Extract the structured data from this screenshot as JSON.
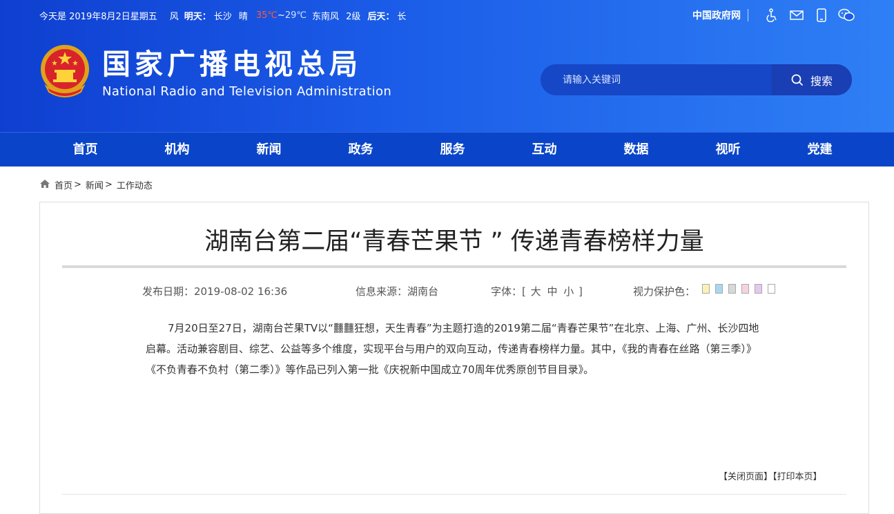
{
  "topbar": {
    "date": "今天是 2019年8月2日星期五",
    "wind": "风",
    "tomorrow_label": "明天：",
    "city": "长沙",
    "weather": "晴",
    "temp_high": "35℃",
    "tilde": "~",
    "temp_low": "29℃",
    "wind_dir": "东南风",
    "wind_level": "2级",
    "day_after_label": "后天：",
    "day_after_city": "长"
  },
  "toplinks": {
    "gov_link": "中国政府网"
  },
  "brand": {
    "name_cn": "国家广播电视总局",
    "name_en": "National Radio and Television Administration"
  },
  "search": {
    "placeholder": "请输入关键词",
    "button": "搜索"
  },
  "nav": [
    "首页",
    "机构",
    "新闻",
    "政务",
    "服务",
    "互动",
    "数据",
    "视听",
    "党建"
  ],
  "breadcrumb": {
    "home": "首页",
    "sep1": ">",
    "news": "新闻",
    "sep2": ">",
    "current": "工作动态"
  },
  "article": {
    "title": "湖南台第二届“青春芒果节 ” 传递青春榜样力量",
    "date_label": "发布日期：",
    "date": "2019-08-02 16:36",
    "source_label": "信息来源：",
    "source": "湖南台",
    "font_label": "字体：",
    "font_open": "[",
    "font_large": "大",
    "font_medium": "中",
    "font_small": "小",
    "font_close": "]",
    "eye_label": "视力保护色：",
    "eye_colors": [
      "#fbf1b7",
      "#a8d8f0",
      "#d8d8d8",
      "#f7d3df",
      "#e4c8f0",
      "#ffffff"
    ],
    "body": "7月20日至27日，湖南台芒果TV以“䨻䨻狂想，天生青春”为主题打造的2019第二届“青春芒果节”在北京、上海、广州、长沙四地启幕。活动兼容剧目、综艺、公益等多个维度，实现平台与用户的双向互动，传递青春榜样力量。其中，《我的青春在丝路（第三季）》《不负青春不负村（第二季）》等作品已列入第一批《庆祝新中国成立70周年优秀原创节目目录》。",
    "close_page": "【关闭页面】",
    "print_page": "【打印本页】"
  }
}
